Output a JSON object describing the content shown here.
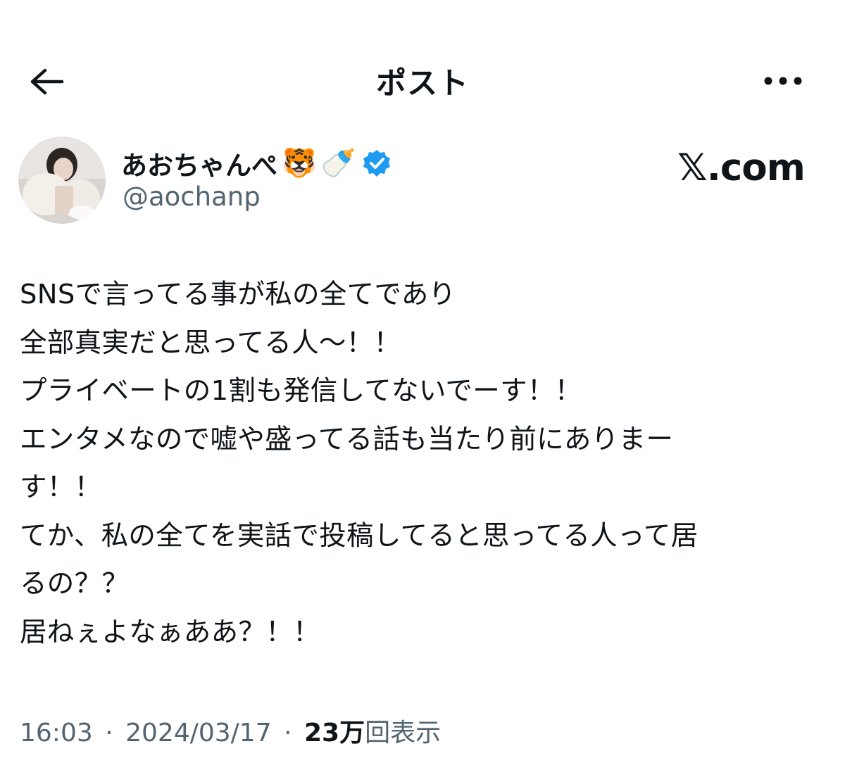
{
  "header": {
    "title": "ポスト",
    "back_icon": "arrow-left-icon",
    "more_icon": "more-horizontal-icon"
  },
  "author": {
    "display_name": "あおちゃんぺ",
    "emojis": [
      "🐯",
      "🍼"
    ],
    "verified_color": "#1d9bf0",
    "handle": "@aochanp"
  },
  "source_mark": "𝕏.com",
  "post": {
    "lines": [
      "SNSで言ってる事が私の全てであり",
      "全部真実だと思ってる人〜！！",
      "プライベートの1割も発信してないでーす！！",
      "エンタメなので嘘や盛ってる話も当たり前にありまー",
      "す！！",
      "てか、私の全てを実話で投稿してると思ってる人って居",
      "るの？？",
      "居ねぇよなぁああ？！！"
    ]
  },
  "meta": {
    "time": "16:03",
    "separator": "·",
    "date": "2024/03/17",
    "views_count": "23万",
    "views_label": "回表示"
  }
}
